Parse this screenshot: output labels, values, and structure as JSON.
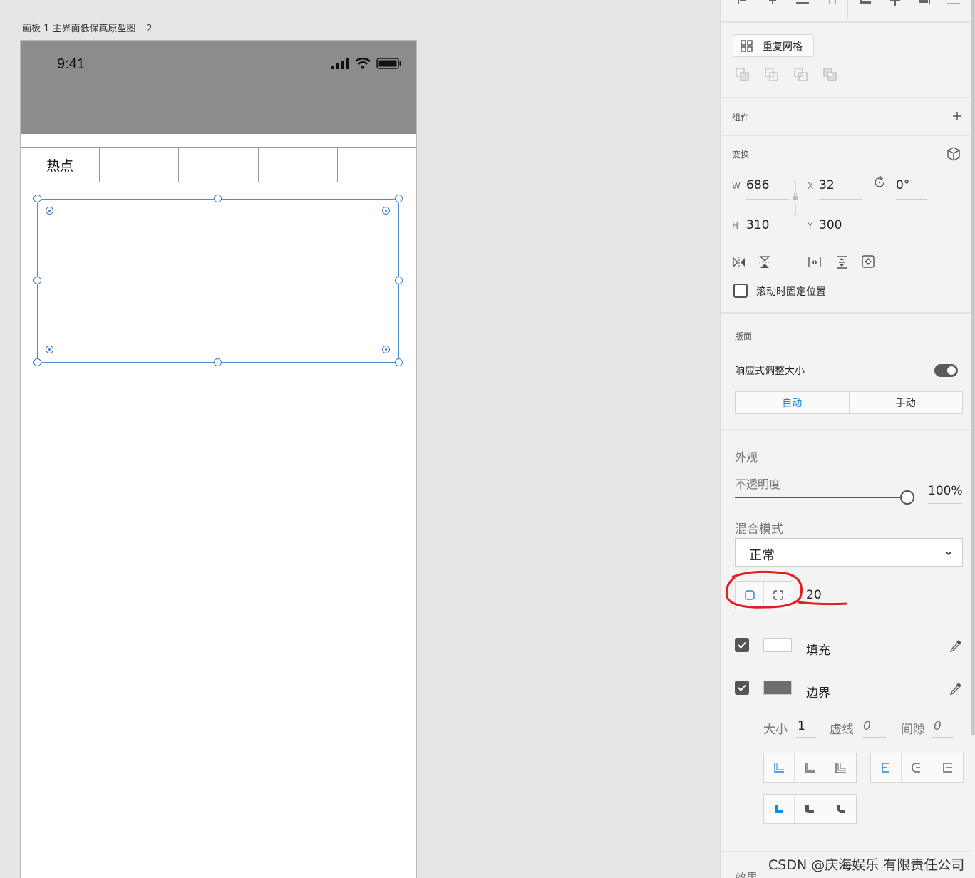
{
  "canvas": {
    "artboard_title": "画板 1 主界面低保真原型图 – 2",
    "status_time": "9:41",
    "tabs": [
      "热点",
      "",
      "",
      "",
      ""
    ]
  },
  "panel": {
    "repeat_grid_label": "重复网格",
    "component_title": "组件",
    "transform_title": "变换",
    "w_label": "W",
    "w_value": "686",
    "h_label": "H",
    "h_value": "310",
    "x_label": "X",
    "x_value": "32",
    "y_label": "Y",
    "y_value": "300",
    "rotation_value": "0°",
    "fix_on_scroll_label": "滚动时固定位置",
    "layout_title": "版面",
    "responsive_label": "响应式调整大小",
    "responsive_on": true,
    "mode_auto": "自动",
    "mode_manual": "手动",
    "appearance_title": "外观",
    "opacity_label": "不透明度",
    "opacity_value": "100%",
    "blend_label": "混合模式",
    "blend_value": "正常",
    "corner_radius_value": "20",
    "fill_label": "填充",
    "fill_color": "#ffffff",
    "border_label": "边界",
    "border_color": "#6e6e6e",
    "size_label": "大小",
    "size_value": "1",
    "dash_label": "虚线",
    "dash_value": "0",
    "gap_label": "间隙",
    "gap_value": "0",
    "effects_title": "效果",
    "accent_color": "#1a8ad6"
  },
  "watermark": "CSDN @庆海娱乐 有限责任公司"
}
